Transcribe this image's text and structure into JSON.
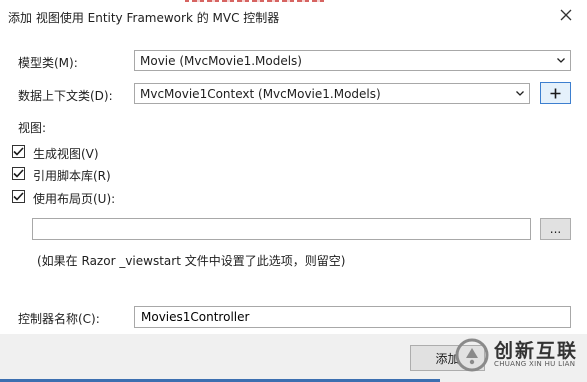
{
  "dialog": {
    "title": "添加 视图使用 Entity Framework 的 MVC 控制器",
    "close_glyph": "✕"
  },
  "fields": {
    "model_class_label": "模型类(M):",
    "model_class_value": "Movie (MvcMovie1.Models)",
    "data_context_label": "数据上下文类(D):",
    "data_context_value": "MvcMovie1Context (MvcMovie1.Models)",
    "add_context_button": "+"
  },
  "views": {
    "section_label": "视图:",
    "options": [
      {
        "label": "生成视图(V)",
        "checked": true
      },
      {
        "label": "引用脚本库(R)",
        "checked": true
      },
      {
        "label": "使用布局页(U):",
        "checked": true
      }
    ],
    "layout_path_value": "",
    "browse_button": "...",
    "hint": "(如果在 Razor _viewstart 文件中设置了此选项，则留空)"
  },
  "controller": {
    "name_label": "控制器名称(C):",
    "name_value": "Movies1Controller"
  },
  "footer": {
    "add_button": "添加"
  },
  "watermark": {
    "text": "创新互联",
    "subtext": "CHUANG XIN HU LIAN"
  },
  "icons": {
    "dropdown": "chevron-down-icon",
    "checkbox": "checkmark-icon",
    "close": "close-icon",
    "plus": "plus-icon"
  }
}
